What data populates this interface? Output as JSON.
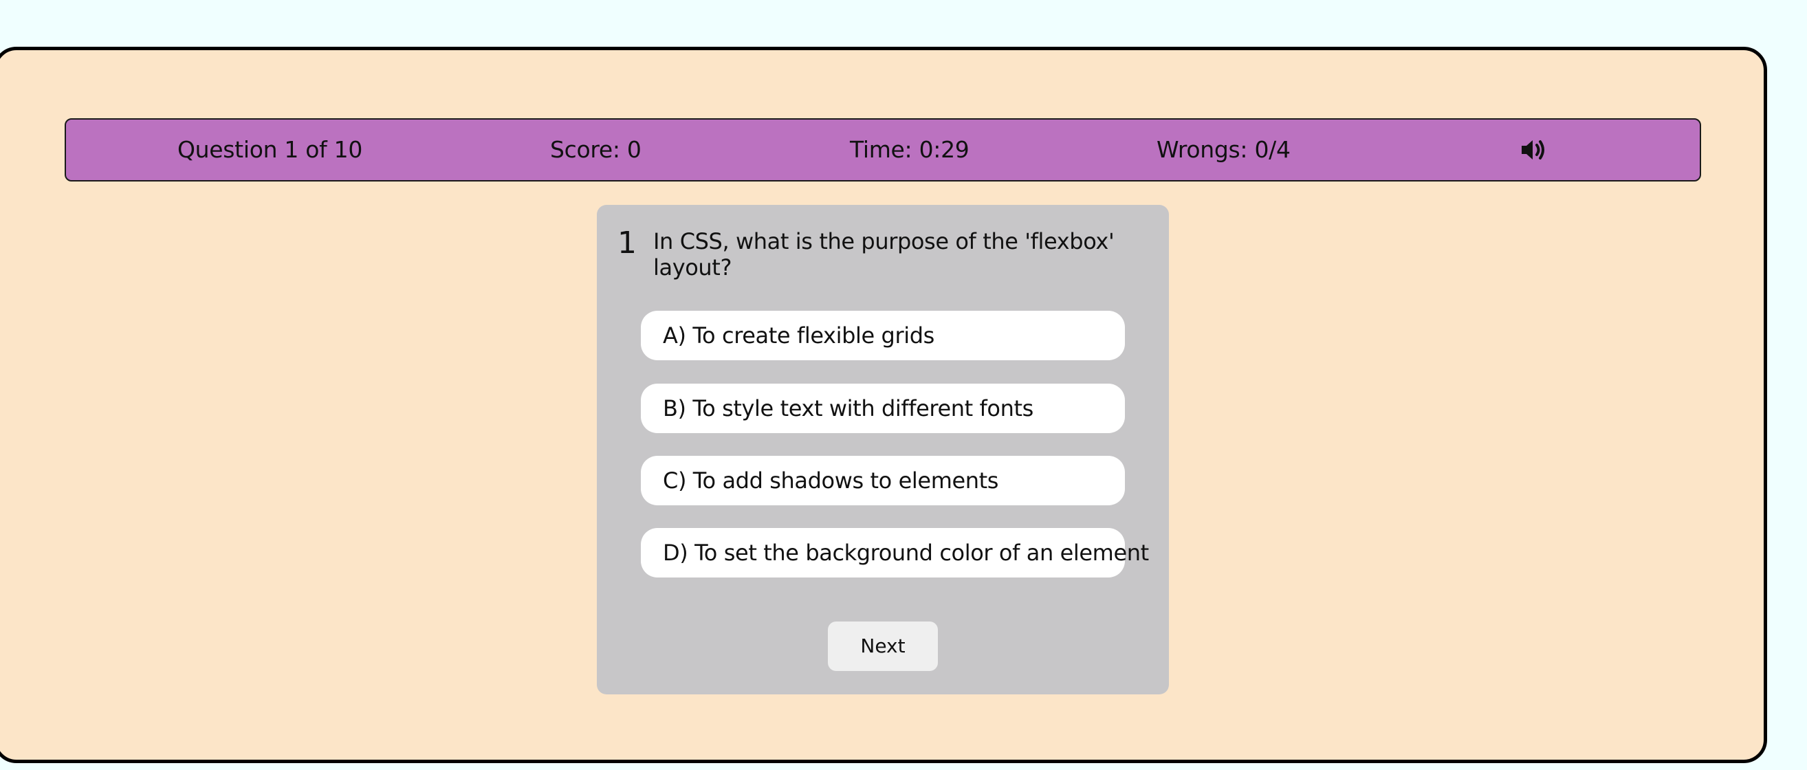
{
  "status_bar": {
    "question_progress": "Question 1 of 10",
    "score": "Score: 0",
    "time": "Time: 0:29",
    "wrongs": "Wrongs: 0/4",
    "sound_icon": "speaker-volume-icon"
  },
  "quiz": {
    "number": "1",
    "question": "In CSS, what is the purpose of the 'flexbox' layout?",
    "options": [
      "A) To create flexible grids",
      "B) To style text with different fonts",
      "C) To add shadows to elements",
      "D) To set the background color of an element"
    ],
    "next_label": "Next"
  },
  "colors": {
    "page_background": "#f0ffff",
    "app_background": "#fce5c8",
    "status_bar": "#bb72c0",
    "card": "#c7c6c8",
    "option": "#ffffff",
    "next_button": "#efefef"
  }
}
